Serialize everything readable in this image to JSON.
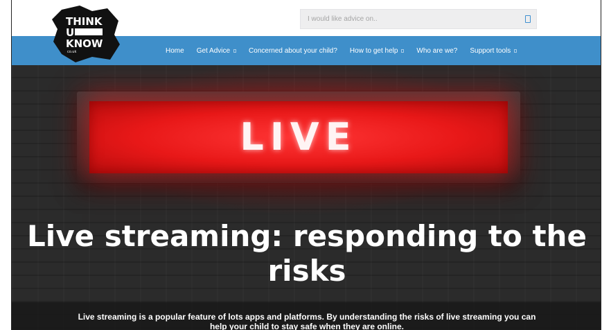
{
  "logo": {
    "line1": "THINK",
    "line2": "U",
    "line3": "KNOW",
    "domain": "co.uk",
    "colors": {
      "ink": "#111111",
      "text": "#ffffff"
    }
  },
  "search": {
    "placeholder": "I would like advice on..",
    "icon": "search-icon"
  },
  "nav": {
    "background": "#3f8fca",
    "items": [
      {
        "label": "Home",
        "has_dropdown": false
      },
      {
        "label": "Get Advice",
        "has_dropdown": true
      },
      {
        "label": "Concerned about your child?",
        "has_dropdown": false
      },
      {
        "label": "How to get help",
        "has_dropdown": true
      },
      {
        "label": "Who are we?",
        "has_dropdown": false
      },
      {
        "label": "Support tools",
        "has_dropdown": true
      }
    ]
  },
  "hero": {
    "sign_text": "LIVE",
    "sign_color": "#e81818",
    "title": "Live streaming: responding to the risks",
    "intro": "Live streaming is a popular feature of lots apps and platforms. By understanding the risks of live streaming you can help your child to stay safe when they are online."
  }
}
